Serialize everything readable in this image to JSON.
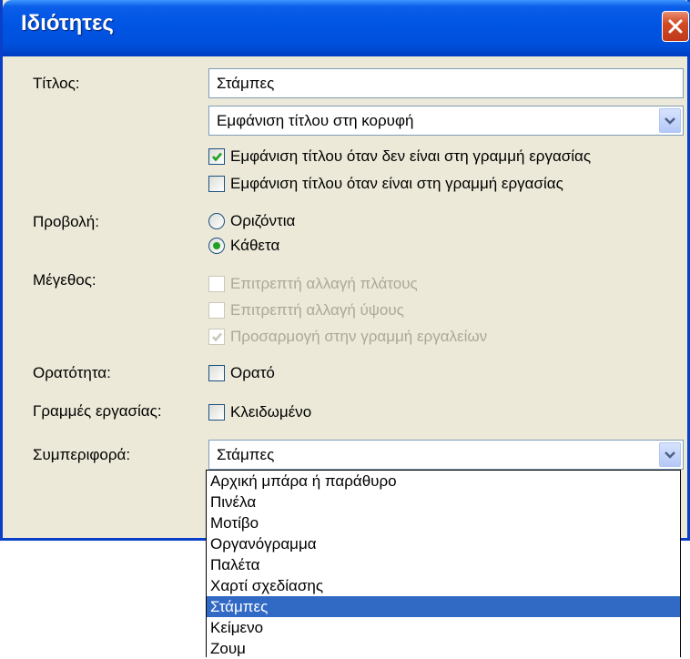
{
  "window": {
    "title": "Ιδιότητες"
  },
  "labels": {
    "title": "Τίτλος:",
    "view": "Προβολή:",
    "size": "Μέγεθος:",
    "visibility": "Ορατότητα:",
    "taskbars": "Γραμμές εργασίας:",
    "behavior": "Συμπεριφορά:"
  },
  "title_input": {
    "value": "Στάμπες"
  },
  "title_position": {
    "selected": "Εμφάνιση τίτλου στη κορυφή"
  },
  "checks": {
    "show_title_not_taskbar": {
      "label": "Εμφάνιση τίτλου όταν δεν είναι στη γραμμή εργασίας",
      "checked": true
    },
    "show_title_taskbar": {
      "label": "Εμφάνιση τίτλου όταν είναι στη γραμμή εργασίας",
      "checked": false
    },
    "allow_width": {
      "label": "Επιτρεπτή αλλαγή πλάτους",
      "checked": false
    },
    "allow_height": {
      "label": "Επιτρεπτή αλλαγή ύψους",
      "checked": false
    },
    "fit_toolbar": {
      "label": "Προσαρμογή στην γραμμή εργαλείων",
      "checked": true
    },
    "visible": {
      "label": "Ορατό",
      "checked": false
    },
    "locked": {
      "label": "Κλειδωμένο",
      "checked": false
    }
  },
  "orientation": {
    "horizontal": {
      "label": "Οριζόντια",
      "selected": false
    },
    "vertical": {
      "label": "Κάθετα",
      "selected": true
    }
  },
  "behavior_combo": {
    "selected": "Στάμπες"
  },
  "behavior_options": [
    "Αρχική μπάρα ή παράθυρο",
    "Πινέλα",
    "Μοτίβο",
    "Οργανόγραμμα",
    "Παλέτα",
    "Χαρτί σχεδίασης",
    "Στάμπες",
    "Κείμενο",
    "Ζουμ"
  ],
  "colors": {
    "titlebar": "#0054e3",
    "selection": "#316ac5",
    "dialog_bg": "#ece9d8"
  }
}
